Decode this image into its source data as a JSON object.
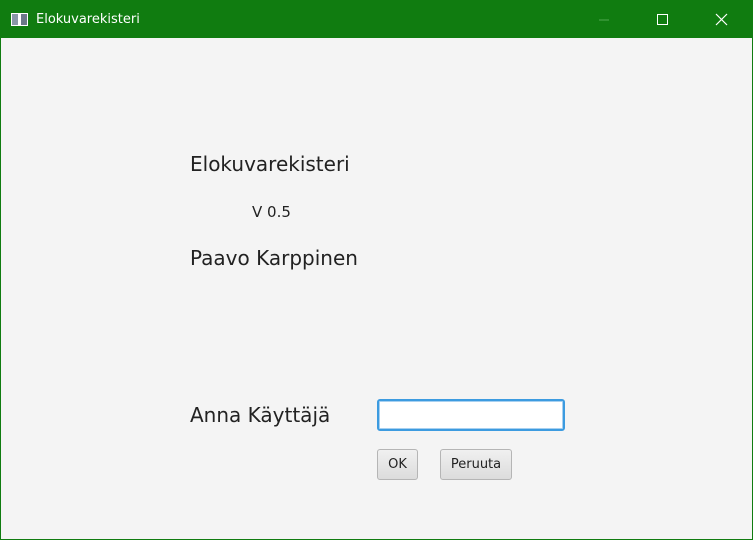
{
  "window": {
    "title": "Elokuvarekisteri",
    "accent_color": "#107c10",
    "controls": {
      "minimize_icon": "minimize-icon",
      "maximize_icon": "maximize-icon",
      "close_icon": "close-icon"
    }
  },
  "dialog": {
    "app_name": "Elokuvarekisteri",
    "version": "V 0.5",
    "author": "Paavo Karppinen",
    "user_label": "Anna Käyttäjä",
    "user_input_value": "",
    "user_input_placeholder": "",
    "ok_label": "OK",
    "cancel_label": "Peruuta",
    "input_focus_color": "#3c9be0"
  }
}
